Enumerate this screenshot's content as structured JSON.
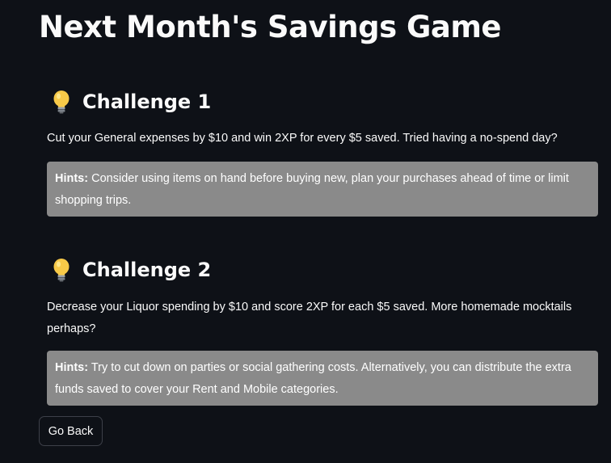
{
  "page": {
    "title": "Next Month's Savings Game"
  },
  "challenges": [
    {
      "icon": "lightbulb-icon",
      "title": "Challenge 1",
      "description": "Cut your General expenses by $10 and win 2XP for every $5 saved. Tried having a no-spend day?",
      "hint_label": "Hints:",
      "hint_text": " Consider using items on hand before buying new, plan your purchases ahead of time or limit shopping trips."
    },
    {
      "icon": "lightbulb-icon",
      "title": "Challenge 2",
      "description": "Decrease your Liquor spending by $10 and score 2XP for each $5 saved. More homemade mocktails perhaps?",
      "hint_label": "Hints:",
      "hint_text": " Try to cut down on parties or social gathering costs. Alternatively, you can distribute the extra funds saved to cover your Rent and Mobile categories."
    }
  ],
  "actions": {
    "go_back_label": "Go Back"
  },
  "colors": {
    "background": "#0e1117",
    "text": "#fafafa",
    "hint_background": "#8a8a8a",
    "button_border": "#3d4049",
    "bulb_yellow": "#f7c948"
  }
}
